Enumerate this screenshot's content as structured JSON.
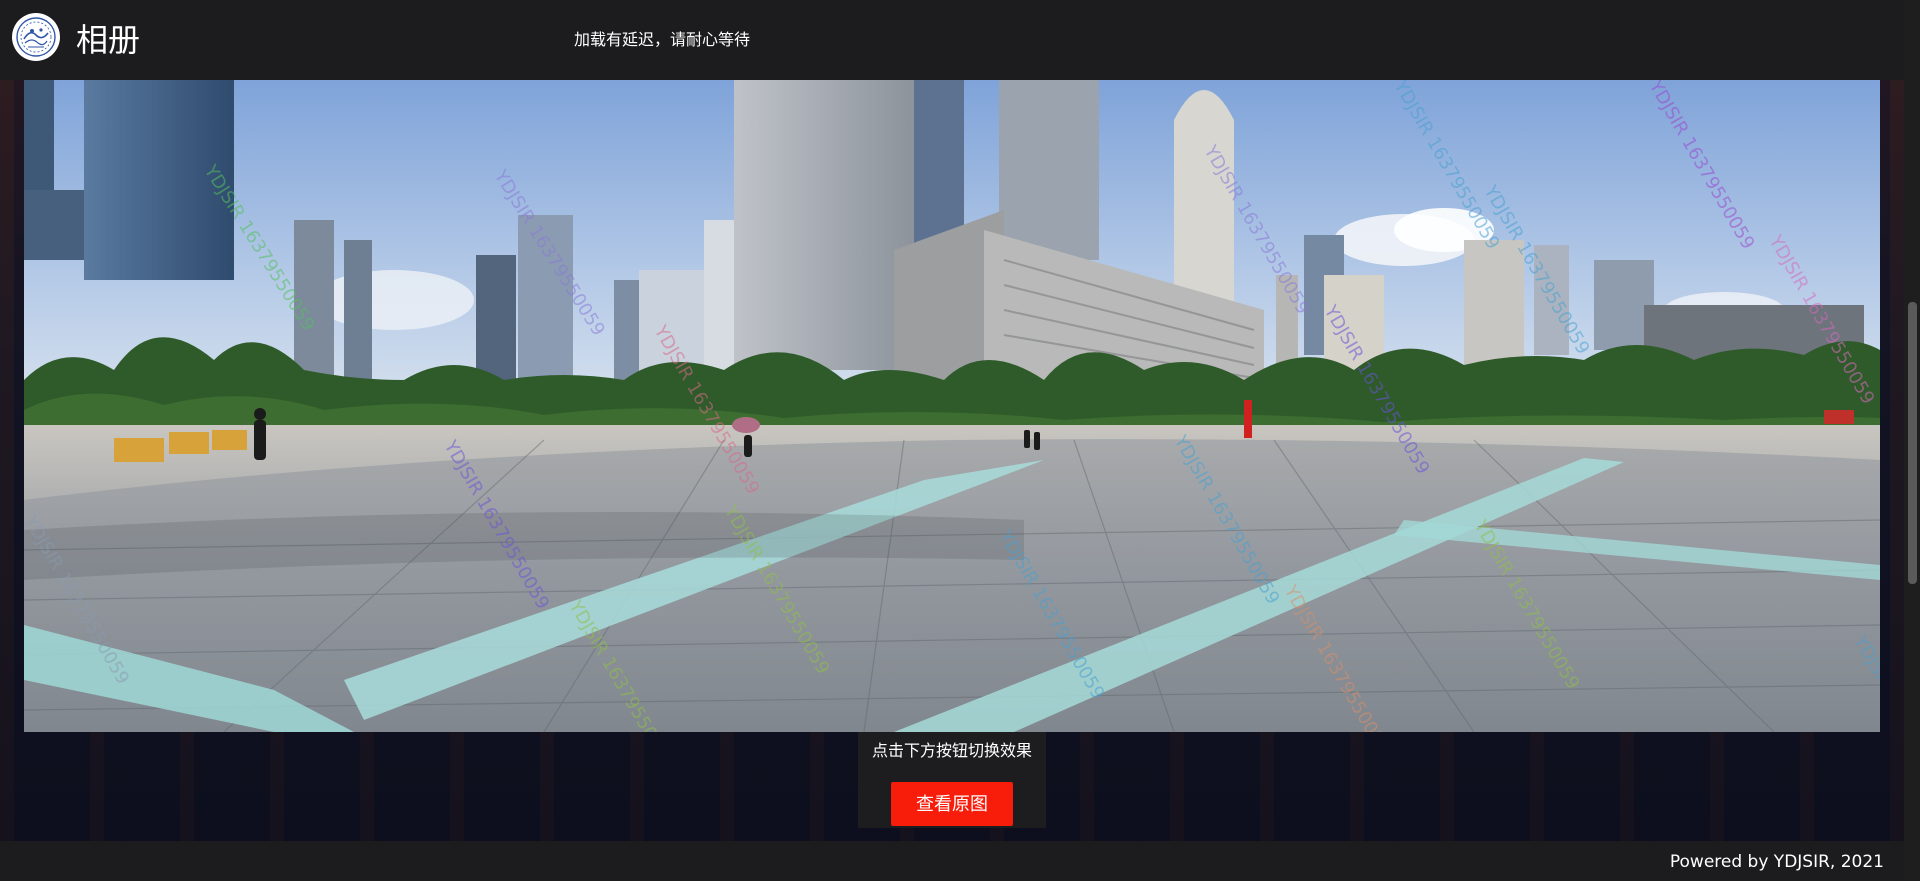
{
  "header": {
    "title": "相册",
    "loading_notice": "加载有延迟，请耐心等待",
    "logo_icon": "logo-emblem-icon"
  },
  "photo": {
    "description_icon": "panorama-photo",
    "watermark_text": "YDJSIR 16379550059"
  },
  "controls": {
    "hint": "点击下方按钮切换效果",
    "toggle_label": "查看原图",
    "button_color": "#f81d0b"
  },
  "footer": {
    "copyright": "Powered by YDJSIR, 2021"
  },
  "colors": {
    "header_bg": "#1c1c1e",
    "accent": "#f81d0b"
  }
}
